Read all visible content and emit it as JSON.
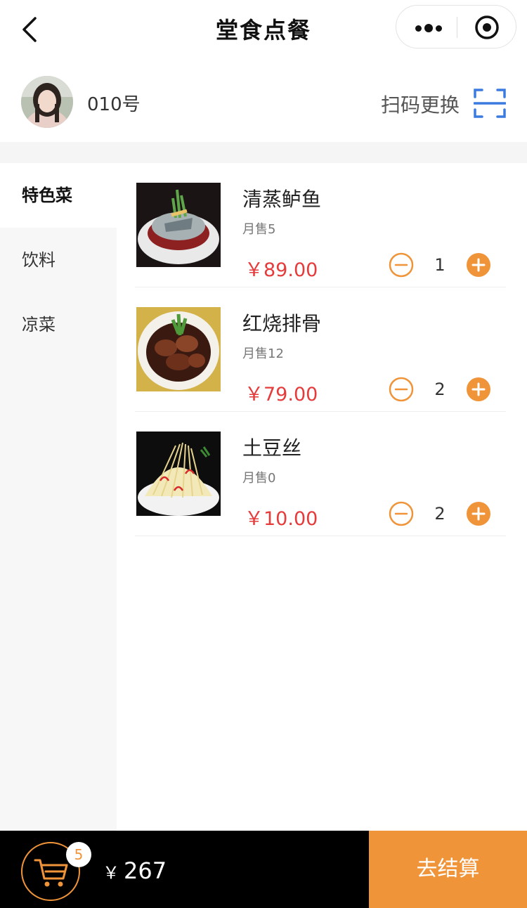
{
  "nav": {
    "title": "堂食点餐"
  },
  "table": {
    "number": "010号",
    "scan_label": "扫码更换"
  },
  "categories": [
    {
      "label": "特色菜",
      "active": true
    },
    {
      "label": "饮料",
      "active": false
    },
    {
      "label": "凉菜",
      "active": false
    }
  ],
  "dishes": [
    {
      "name": "清蒸鲈鱼",
      "sales": "月售5",
      "price": "￥89.00",
      "qty": "1"
    },
    {
      "name": "红烧排骨",
      "sales": "月售12",
      "price": "￥79.00",
      "qty": "2"
    },
    {
      "name": "土豆丝",
      "sales": "月售0",
      "price": "￥10.00",
      "qty": "2"
    }
  ],
  "cart": {
    "count": "5",
    "currency": "￥",
    "total": "267",
    "checkout_label": "去结算"
  },
  "colors": {
    "accent": "#f0943a",
    "price": "#e63b3b",
    "scan_icon": "#3b7be0"
  },
  "icons": {
    "back": "chevron-left-icon",
    "more": "more-dots-icon",
    "close": "target-circle-icon",
    "scan": "scan-frame-icon",
    "minus": "minus-circle-icon",
    "plus": "plus-circle-icon",
    "cart": "cart-icon"
  }
}
